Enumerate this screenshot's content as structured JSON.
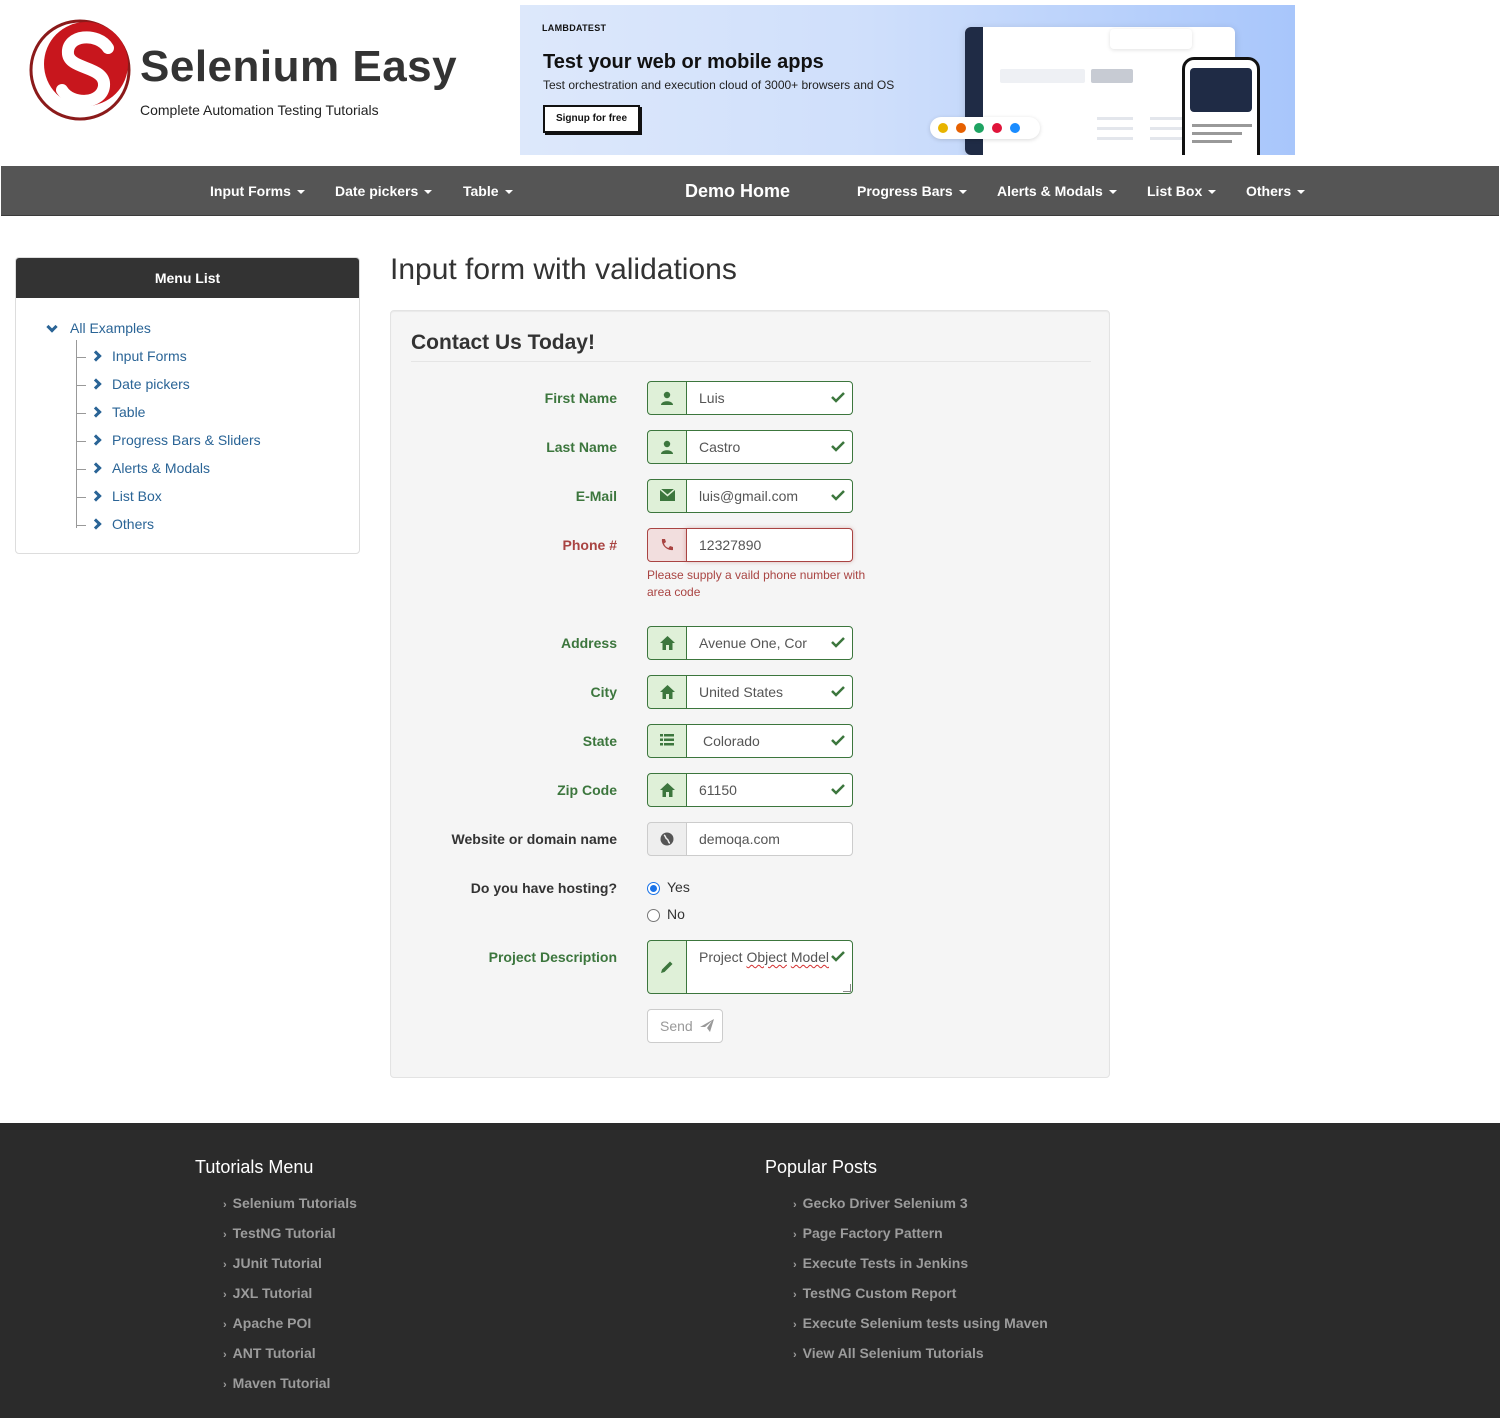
{
  "header": {
    "brand": "Selenium Easy",
    "tagline": "Complete Automation Testing Tutorials",
    "ad": {
      "brand": "LAMBDATEST",
      "title": "Test your web or mobile apps",
      "subtitle": "Test orchestration and execution cloud of 3000+ browsers and OS",
      "cta": "Signup for free"
    }
  },
  "nav": {
    "items": [
      "Input Forms",
      "Date pickers",
      "Table",
      "Demo Home",
      "Progress Bars",
      "Alerts & Modals",
      "List Box",
      "Others"
    ]
  },
  "sidebar": {
    "title": "Menu List",
    "root": "All Examples",
    "items": [
      "Input Forms",
      "Date pickers",
      "Table",
      "Progress Bars & Sliders",
      "Alerts & Modals",
      "List Box",
      "Others"
    ]
  },
  "main": {
    "title": "Input form with validations",
    "legend": "Contact Us Today!",
    "fields": {
      "first_name": {
        "label": "First Name",
        "value": "Luis"
      },
      "last_name": {
        "label": "Last Name",
        "value": "Castro"
      },
      "email": {
        "label": "E-Mail",
        "value": "luis@gmail.com"
      },
      "phone": {
        "label": "Phone #",
        "value": "12327890",
        "error": "Please supply a vaild phone number with area code"
      },
      "address": {
        "label": "Address",
        "value": "Avenue One, Cor"
      },
      "city": {
        "label": "City",
        "value": "United States"
      },
      "state": {
        "label": "State",
        "value": "Colorado"
      },
      "zip": {
        "label": "Zip Code",
        "value": "61150"
      },
      "website": {
        "label": "Website or domain name",
        "value": "demoqa.com"
      },
      "hosting": {
        "label": "Do you have hosting?",
        "options": [
          "Yes",
          "No"
        ],
        "selected": "Yes"
      },
      "description": {
        "label": "Project Description",
        "value_word1": "Project",
        "value_word2": "Object",
        "value_word3": "Model"
      }
    },
    "send_label": "Send"
  },
  "footer": {
    "tutorials_title": "Tutorials Menu",
    "tutorials": [
      "Selenium Tutorials",
      "TestNG Tutorial",
      "JUnit Tutorial",
      "JXL Tutorial",
      "Apache POI",
      "ANT Tutorial",
      "Maven Tutorial"
    ],
    "posts_title": "Popular Posts",
    "posts": [
      "Gecko Driver Selenium 3",
      "Page Factory Pattern",
      "Execute Tests in Jenkins",
      "TestNG Custom Report",
      "Execute Selenium tests using Maven",
      "View All Selenium Tutorials"
    ]
  },
  "colors": {
    "nav_bg": "#555555",
    "success": "#3c763d",
    "error": "#a94442",
    "link": "#2a6496",
    "footer_bg": "#2b2b2b"
  },
  "icons": {
    "first_name": "user-icon",
    "last_name": "user-icon",
    "email": "envelope-icon",
    "phone": "phone-icon",
    "address": "home-icon",
    "city": "home-icon",
    "state": "list-icon",
    "zip": "home-icon",
    "website": "globe-icon",
    "description": "pencil-icon",
    "send": "send-icon"
  }
}
